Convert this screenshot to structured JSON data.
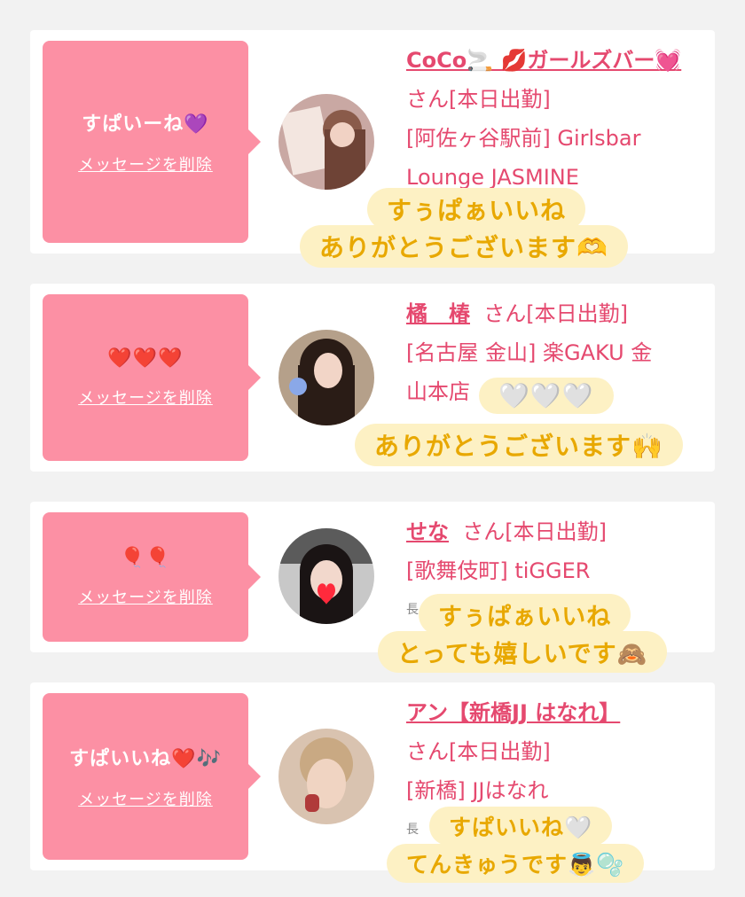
{
  "cards": [
    {
      "message": "すぱいーね💜",
      "delete_label": "メッセージを削除",
      "name": "CoCo🚬 💋ガールズバー💓",
      "name_suffix": "さん[本日出勤]",
      "shop_line1": "[阿佐ヶ谷駅前] Girlsbar",
      "shop_line2": "Lounge JASMINE",
      "sticker_line1": "すぅぱぁいいね",
      "sticker_line2": "ありがとうございます🫶"
    },
    {
      "message": "❤️❤️❤️",
      "delete_label": "メッセージを削除",
      "name": "橘　椿",
      "name_suffix": "さん[本日出勤]",
      "shop_line1": "[名古屋 金山] 楽GAKU 金",
      "shop_line2": "山本店",
      "sticker_line1": "🤍🤍🤍",
      "sticker_line2": "ありがとうございます🙌"
    },
    {
      "message": "🎈🎈",
      "delete_label": "メッセージを削除",
      "name": "せな",
      "name_suffix": "さん[本日出勤]",
      "shop_line1": "[歌舞伎町] tiGGER",
      "shop_line2": "長",
      "sticker_line1": "すぅぱぁいいね",
      "sticker_line2": "とっても嬉しいです🙈"
    },
    {
      "message": "すぱいいね❤️🎶",
      "delete_label": "メッセージを削除",
      "name": "アン【新橋JJ はなれ】",
      "name_suffix": "さん[本日出勤]",
      "shop_line1": "[新橋] JJはなれ",
      "shop_line2": "長",
      "sticker_line1": "すぱいいね🤍",
      "sticker_line2": "てんきゅうです👼🫧"
    }
  ]
}
